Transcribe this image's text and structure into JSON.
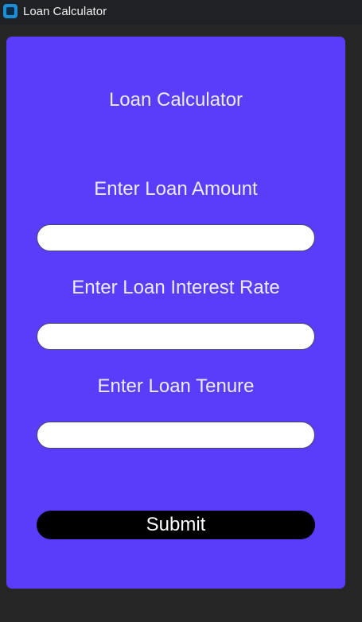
{
  "window": {
    "title": "Loan Calculator",
    "icon": "app-icon"
  },
  "form": {
    "title": "Loan Calculator",
    "amount_label": "Enter Loan Amount",
    "amount_value": "",
    "interest_label": "Enter Loan Interest Rate",
    "interest_value": "",
    "tenure_label": "Enter Loan Tenure",
    "tenure_value": "",
    "submit_label": "Submit"
  },
  "colors": {
    "background": "#262626",
    "titlebar": "#202124",
    "card": "#5a3dfa",
    "text": "#ececf7",
    "button": "#000000"
  }
}
